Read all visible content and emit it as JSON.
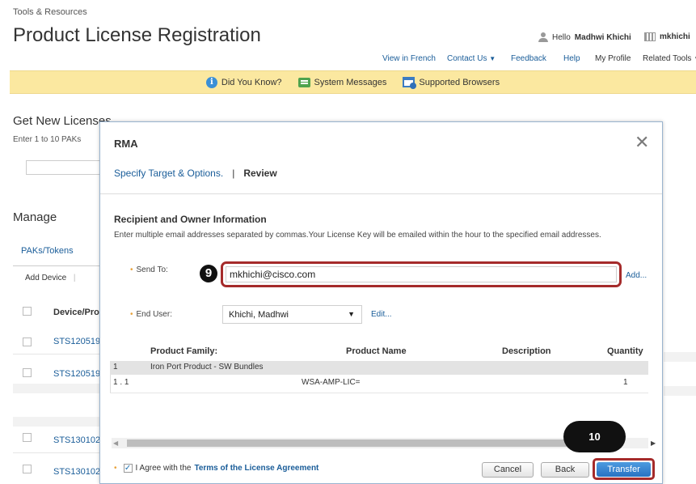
{
  "header": {
    "breadcrumb": "Tools & Resources",
    "title": "Product License Registration",
    "hello_prefix": "Hello",
    "user_name": "Madhwi Khichi",
    "user_short": "mkhichi"
  },
  "top_nav": [
    "View in French",
    "Contact Us",
    "Feedback",
    "Help",
    "My Profile",
    "Related Tools"
  ],
  "info_bar": {
    "did_you_know": "Did You Know?",
    "system_messages": "System Messages",
    "supported_browsers": "Supported Browsers"
  },
  "background": {
    "get_new": "Get New Licenses",
    "enter_hint": "Enter 1 to 10 PAKs",
    "manage": "Manage",
    "paks_tab": "PAKs/Tokens",
    "add_device": "Add Device",
    "col_device": "Device/Pro",
    "rows": [
      "STS120519",
      "STS120519",
      "STS130102",
      "STS130102"
    ]
  },
  "modal": {
    "title": "RMA",
    "step1": "Specify Target & Options.",
    "step_sep": "|",
    "step2": "Review",
    "section_title": "Recipient and Owner Information",
    "section_desc": "Enter multiple email addresses separated by commas.Your License Key will be emailed within the hour to the specified email addresses.",
    "send_to_label": "Send To:",
    "send_to_value": "mkhichi@cisco.com",
    "add_link": "Add...",
    "end_user_label": "End User:",
    "end_user_value": "Khichi, Madhwi",
    "edit_link": "Edit...",
    "table": {
      "headers": {
        "family": "Product Family:",
        "name": "Product Name",
        "description": "Description",
        "quantity": "Quantity"
      },
      "group_num": "1",
      "group_family": "Iron Port Product - SW Bundles",
      "item_num": "1 . 1",
      "item_name": "WSA-AMP-LIC=",
      "item_qty": "1"
    },
    "agree_prefix": "I Agree with the",
    "terms_link": "Terms of the License Agreement",
    "cancel": "Cancel",
    "back": "Back",
    "transfer": "Transfer"
  },
  "annotations": {
    "badge_9": "9",
    "badge_10": "10"
  },
  "colors": {
    "link": "#1a5d99",
    "info_bar": "#fbe8a0",
    "highlight": "#a52b2b",
    "primary_button": "#2872c2"
  }
}
